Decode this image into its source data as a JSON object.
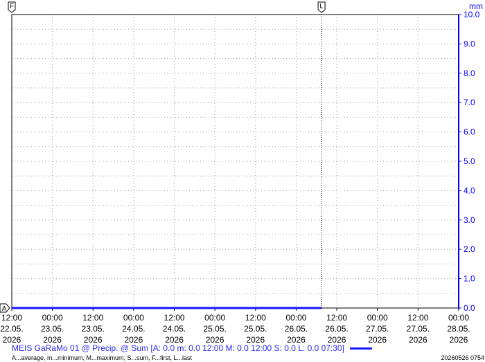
{
  "chart_data": {
    "type": "line",
    "title": "",
    "xlabel": "",
    "ylabel": "mm",
    "ylim": [
      0,
      10
    ],
    "y_ticks": [
      "0.0",
      "1.0",
      "2.0",
      "3.0",
      "4.0",
      "5.0",
      "6.0",
      "7.0",
      "8.0",
      "9.0",
      "10.0"
    ],
    "x_ticks": [
      {
        "time": "12:00",
        "date": "22.05.",
        "year": "2026"
      },
      {
        "time": "00:00",
        "date": "23.05.",
        "year": "2026"
      },
      {
        "time": "12:00",
        "date": "23.05.",
        "year": "2026"
      },
      {
        "time": "00:00",
        "date": "24.05.",
        "year": "2026"
      },
      {
        "time": "12:00",
        "date": "24.05.",
        "year": "2026"
      },
      {
        "time": "00:00",
        "date": "25.05.",
        "year": "2026"
      },
      {
        "time": "12:00",
        "date": "25.05.",
        "year": "2026"
      },
      {
        "time": "00:00",
        "date": "26.05.",
        "year": "2026"
      },
      {
        "time": "12:00",
        "date": "26.05.",
        "year": "2026"
      },
      {
        "time": "00:00",
        "date": "27.05.",
        "year": "2026"
      },
      {
        "time": "12:00",
        "date": "27.05.",
        "year": "2026"
      },
      {
        "time": "00:00",
        "date": "28.05.",
        "year": "2026"
      }
    ],
    "x_range": [
      "2026-05-22 12:00",
      "2026-05-28 00:00"
    ],
    "series": [
      {
        "name": "MEIS GaRaMo 01 @ Precip. @ Sum",
        "color": "#1515ff",
        "x": [
          "2026-05-22 12:00",
          "2026-05-26 07:30"
        ],
        "values": [
          0.0,
          0.0
        ]
      }
    ],
    "markers": {
      "first": "F",
      "last": "L",
      "axis": "A"
    },
    "last_marker_time": "2026-05-26 07:30",
    "grid": true,
    "legend": "bottom"
  },
  "caption": {
    "series_text": "MEIS GaRaMo 01 @ Precip. @ Sum [A: 0.0 m: 0.0 12:00 M: 0.0 12:00 S: 0.0 L: 0.0 07:30]",
    "legend_text": "A...average, m...minimum, M...maximum, S...sum, F...first, L...last",
    "timestamp": "20260526 0754"
  },
  "colors": {
    "axis_blue": "#0000ff",
    "series_blue": "#1515ff",
    "caption_blue": "#2a2af0",
    "grid": "#a0a0a0"
  }
}
